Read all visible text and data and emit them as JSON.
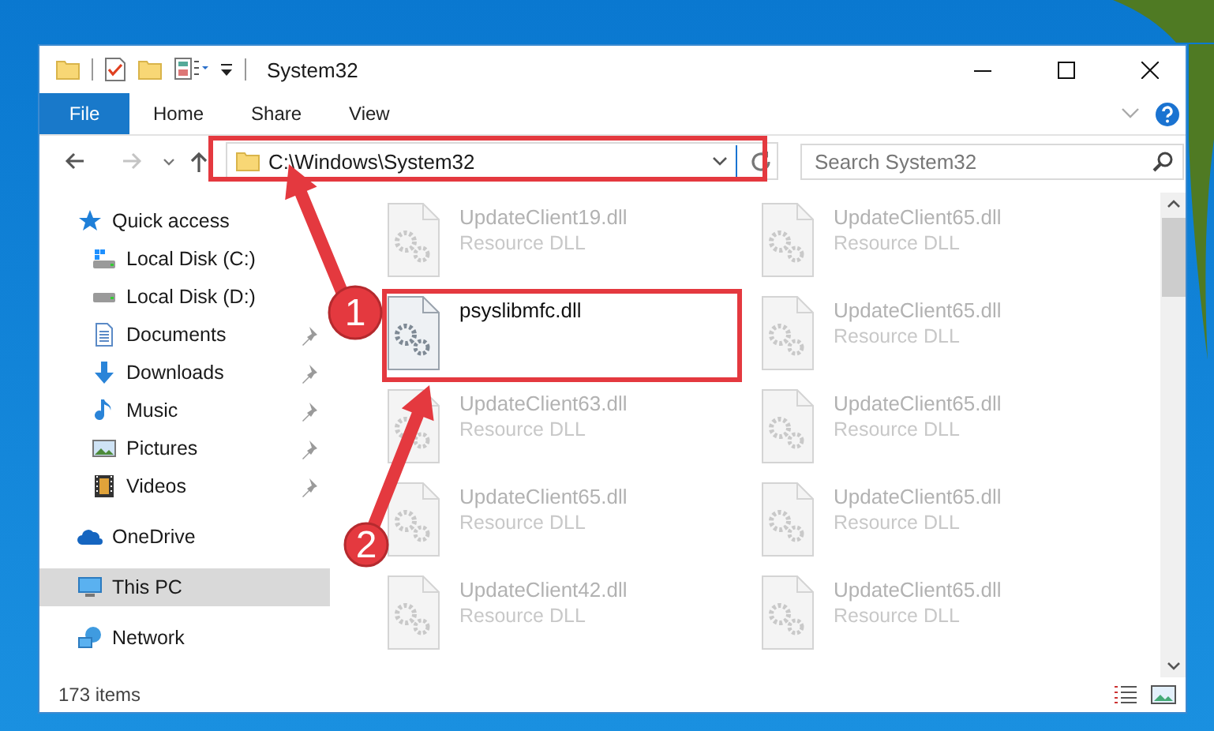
{
  "window": {
    "title": "System32"
  },
  "ribbon": {
    "tabs": [
      {
        "label": "File",
        "kind": "file"
      },
      {
        "label": "Home",
        "kind": "tab"
      },
      {
        "label": "Share",
        "kind": "tab"
      },
      {
        "label": "View",
        "kind": "tab"
      }
    ]
  },
  "address": {
    "path": "C:\\Windows\\System32"
  },
  "search": {
    "placeholder": "Search System32"
  },
  "sidebar": {
    "items": [
      {
        "label": "Quick access",
        "kind": "star",
        "selected": false,
        "pinned": false,
        "children": [
          {
            "label": "Local Disk (C:)",
            "kind": "systemdrive",
            "selected": false,
            "pinned": false
          },
          {
            "label": "Local Disk (D:)",
            "kind": "drive",
            "selected": false,
            "pinned": false
          },
          {
            "label": "Documents",
            "kind": "documents",
            "selected": false,
            "pinned": true
          },
          {
            "label": "Downloads",
            "kind": "downloads",
            "selected": false,
            "pinned": true
          },
          {
            "label": "Music",
            "kind": "music",
            "selected": false,
            "pinned": true
          },
          {
            "label": "Pictures",
            "kind": "pictures",
            "selected": false,
            "pinned": true
          },
          {
            "label": "Videos",
            "kind": "videos",
            "selected": false,
            "pinned": true
          }
        ]
      },
      {
        "label": "OneDrive",
        "kind": "cloud",
        "selected": false,
        "pinned": false
      },
      {
        "label": "This PC",
        "kind": "pc",
        "selected": true,
        "pinned": false
      },
      {
        "label": "Network",
        "kind": "network",
        "selected": false,
        "pinned": false
      }
    ]
  },
  "files": [
    {
      "name": "UpdateClient19.dll",
      "type": "Resource DLL",
      "blurred": true
    },
    {
      "name": "UpdateClient65.dll",
      "type": "Resource DLL",
      "blurred": true
    },
    {
      "name": "psyslibmfc.dll",
      "blurred": false
    },
    {
      "name": "UpdateClient65.dll",
      "type": "Resource DLL",
      "blurred": true
    },
    {
      "name": "UpdateClient63.dll",
      "type": "Resource DLL",
      "blurred": true
    },
    {
      "name": "UpdateClient65.dll",
      "type": "Resource DLL",
      "blurred": true
    },
    {
      "name": "UpdateClient65.dll",
      "type": "Resource DLL",
      "blurred": true
    },
    {
      "name": "UpdateClient65.dll",
      "type": "Resource DLL",
      "blurred": true
    },
    {
      "name": "UpdateClient42.dll",
      "type": "Resource DLL",
      "blurred": true
    },
    {
      "name": "UpdateClient65.dll",
      "type": "Resource DLL",
      "blurred": true
    }
  ],
  "status_bar": {
    "count": "173 items"
  },
  "annotations": [
    {
      "number": "1"
    },
    {
      "number": "2"
    }
  ]
}
